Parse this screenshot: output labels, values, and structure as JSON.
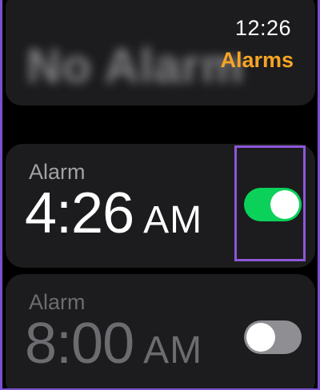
{
  "status": {
    "time": "12:26",
    "title": "Alarms",
    "background_text": "No Alarm"
  },
  "alarms": [
    {
      "label": "Alarm",
      "time": "4:26",
      "period": "AM",
      "enabled": true
    },
    {
      "label": "Alarm",
      "time": "8:00",
      "period": "AM",
      "enabled": false
    }
  ],
  "colors": {
    "accent": "#f7a425",
    "toggle_on": "#0bd15a",
    "toggle_off": "#8e8e93",
    "highlight": "#8d57d8",
    "card": "#1c1c1e"
  }
}
